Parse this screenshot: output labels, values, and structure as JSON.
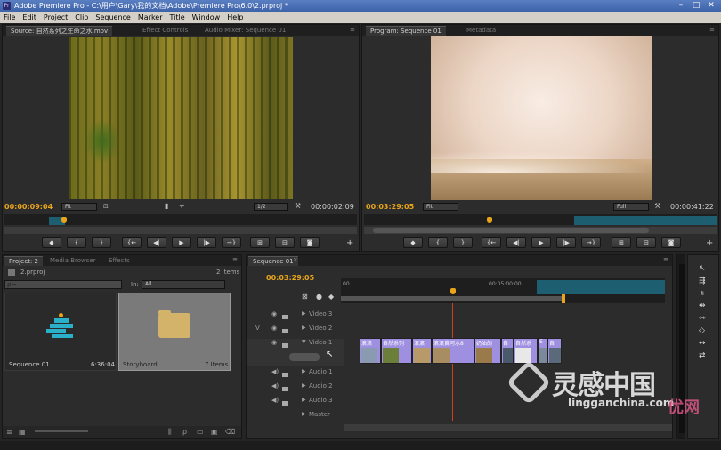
{
  "window": {
    "title": "Adobe Premiere Pro - C:\\用户\\Gary\\我的文档\\Adobe\\Premiere Pro\\6.0\\2.prproj *"
  },
  "menu": [
    "File",
    "Edit",
    "Project",
    "Clip",
    "Sequence",
    "Marker",
    "Title",
    "Window",
    "Help"
  ],
  "source": {
    "tabs": [
      "Source: 自然系列之生命之水.mov",
      "Effect Controls",
      "Audio Mixer: Sequence 01"
    ],
    "timecode_in": "00:00:09:04",
    "timecode_dur": "00:00:02:09",
    "fit": "Fit",
    "res": "1/2"
  },
  "program": {
    "tabs": [
      "Program: Sequence 01",
      "Metadata"
    ],
    "timecode_in": "00:03:29:05",
    "timecode_dur": "00:00:41:22",
    "fit": "Fit",
    "res": "Full"
  },
  "transport": {
    "marker": "◆",
    "in": "{",
    "out": "}",
    "goto_in": "{←",
    "step_back": "◀|",
    "play": "▶",
    "step_fwd": "|▶",
    "goto_out": "→}",
    "add": "+"
  },
  "project": {
    "tabs": [
      "Project: 2",
      "Media Browser",
      "Effects"
    ],
    "file": "2.prproj",
    "count": "2 Items",
    "search_placeholder": "ρ¬",
    "in_label": "In:",
    "in_value": "All",
    "items": [
      {
        "name": "Sequence 01",
        "meta": "6:36:04"
      },
      {
        "name": "Storyboard",
        "meta": "7 Items"
      }
    ]
  },
  "timeline": {
    "tab": "Sequence 01",
    "timecode": "00:03:29:05",
    "ruler_start": "00",
    "ruler_mid": "00:05:00:00",
    "tracks": [
      "Video 3",
      "Video 2",
      "Video 1",
      "Audio 1",
      "Audio 2",
      "Audio 3",
      "Master"
    ],
    "v_label": "V",
    "clips": [
      {
        "label": "滚滚",
        "color": "#9f8fe0"
      },
      {
        "label": "自然系列",
        "color": "#9f8fe0"
      },
      {
        "label": "滚滚",
        "color": "#9f8fe0"
      },
      {
        "label": "滚滚黄河水8",
        "color": "#9f8fe0"
      },
      {
        "label": "奶油的",
        "color": "#9f8fe0"
      },
      {
        "label": "自",
        "color": "#9f8fe0"
      },
      {
        "label": "自然系",
        "color": "#9f8fe0"
      },
      {
        "label": "E",
        "color": "#9f8fe0"
      },
      {
        "label": "自",
        "color": "#9f8fe0"
      }
    ]
  },
  "watermark": {
    "text1": "灵感中国",
    "text2": "lingganchina.com",
    "text3": "优网"
  },
  "colors": {
    "accent": "#e8a41a",
    "teal": "#2a6e7a",
    "clip": "#9f8fe0"
  }
}
